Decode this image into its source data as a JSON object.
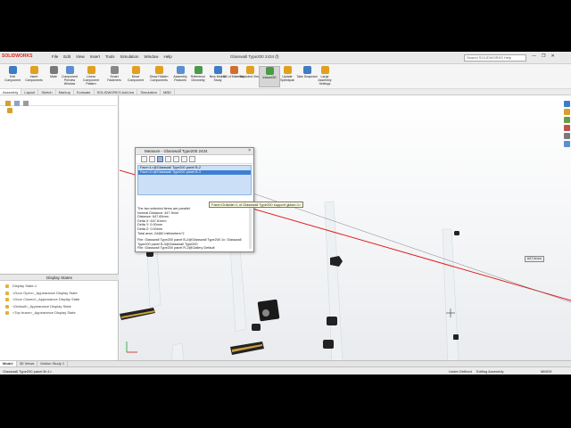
{
  "app": {
    "logo": "SOLIDWORKS",
    "menu": [
      "File",
      "Edit",
      "View",
      "Insert",
      "Tools",
      "Simulation",
      "Window",
      "Help"
    ],
    "document_title": "Glasswall Type200 2434 (f)",
    "search_placeholder": "Search SOLIDWORKS Help",
    "window_controls": [
      "—",
      "❐",
      "✕"
    ]
  },
  "ribbon": [
    {
      "label": "Edit Component",
      "icon": "edit-component-icon",
      "color": "#3e7cc4"
    },
    {
      "label": "Insert Components",
      "icon": "insert-components-icon",
      "color": "#e0a020"
    },
    {
      "label": "Mate",
      "icon": "mate-icon",
      "color": "#7a7a7a"
    },
    {
      "label": "Component Preview Window",
      "icon": "preview-window-icon",
      "color": "#5a8fd0"
    },
    {
      "label": "Linear Component Pattern",
      "icon": "pattern-icon",
      "color": "#e0a020"
    },
    {
      "label": "Smart Fasteners",
      "icon": "fastener-icon",
      "color": "#888888"
    },
    {
      "label": "Move Component",
      "icon": "move-icon",
      "color": "#e0a020"
    },
    {
      "label": "Show Hidden Components",
      "icon": "show-hidden-icon",
      "color": "#e0a020"
    },
    {
      "label": "Assembly Features",
      "icon": "assembly-features-icon",
      "color": "#5a8fd0"
    },
    {
      "label": "Reference Geometry",
      "icon": "reference-geometry-icon",
      "color": "#4a9a4a"
    },
    {
      "label": "New Motion Study",
      "icon": "motion-study-icon",
      "color": "#3e7cc4"
    },
    {
      "label": "Bill of Materials",
      "icon": "bom-icon",
      "color": "#d07030"
    },
    {
      "label": "Exploded View",
      "icon": "exploded-view-icon",
      "color": "#e0a020"
    },
    {
      "label": "Instant3D",
      "icon": "instant3d-icon",
      "color": "#4a9a4a"
    },
    {
      "label": "Update Speedpak",
      "icon": "speedpak-icon",
      "color": "#e0a020"
    },
    {
      "label": "Take Snapshot",
      "icon": "snapshot-icon",
      "color": "#3e7cc4"
    },
    {
      "label": "Large Assembly Settings",
      "icon": "large-assembly-icon",
      "color": "#e0a020"
    }
  ],
  "command_tabs": [
    "Assembly",
    "Layout",
    "Sketch",
    "Markup",
    "Evaluate",
    "SOLIDWORKS Add-Ins",
    "Simulation",
    "MBD"
  ],
  "measure_dialog": {
    "title": "Measure - Glasswall Type200 2434",
    "selections": [
      "Face<1>@Glasswall Type200 panel B-2",
      "Face<2>@Glasswall Type200 panel B-3"
    ],
    "results": [
      "The two selected items are parallel.",
      "Normal Distance: 447.9mm",
      "Distance: 647.65mm",
      "Delta X: 647.61mm",
      "Delta Y: 0.00mm",
      "Delta Z: 0.00mm",
      "Total area: 24480 millimeters^2",
      "",
      "File: Glasswall Type200 panel B-2@Glasswall Type200 1x: Glasswall",
      "Type200 panel B-3@Glasswall Type200",
      "File: Glasswall Type200 panel R-2@Gallery Default"
    ]
  },
  "tooltip": "Face<Outside>1 of Glasswall Type200 support glass<1>",
  "dimension_label": "647.6mm",
  "display_states": {
    "header": "Display States",
    "items": [
      "Display State-1",
      "<Door Open>_Appearance Display State",
      "<Door Closed>_Appearance Display State",
      "<Default>_Appearance Display State",
      "<Top brace>_Appearance Display State"
    ]
  },
  "bottom_tabs": [
    "Model",
    "3D Views",
    "Motion Study 1"
  ],
  "status": {
    "left": "Glasswall Type200 panel B<1>",
    "under_defined": "Under Defined",
    "editing": "Editing Assembly",
    "units": "MMGS"
  },
  "colors": {
    "accent": "#3d7fd3",
    "measure_line": "#e02020",
    "selection": "#cbe0f7"
  }
}
